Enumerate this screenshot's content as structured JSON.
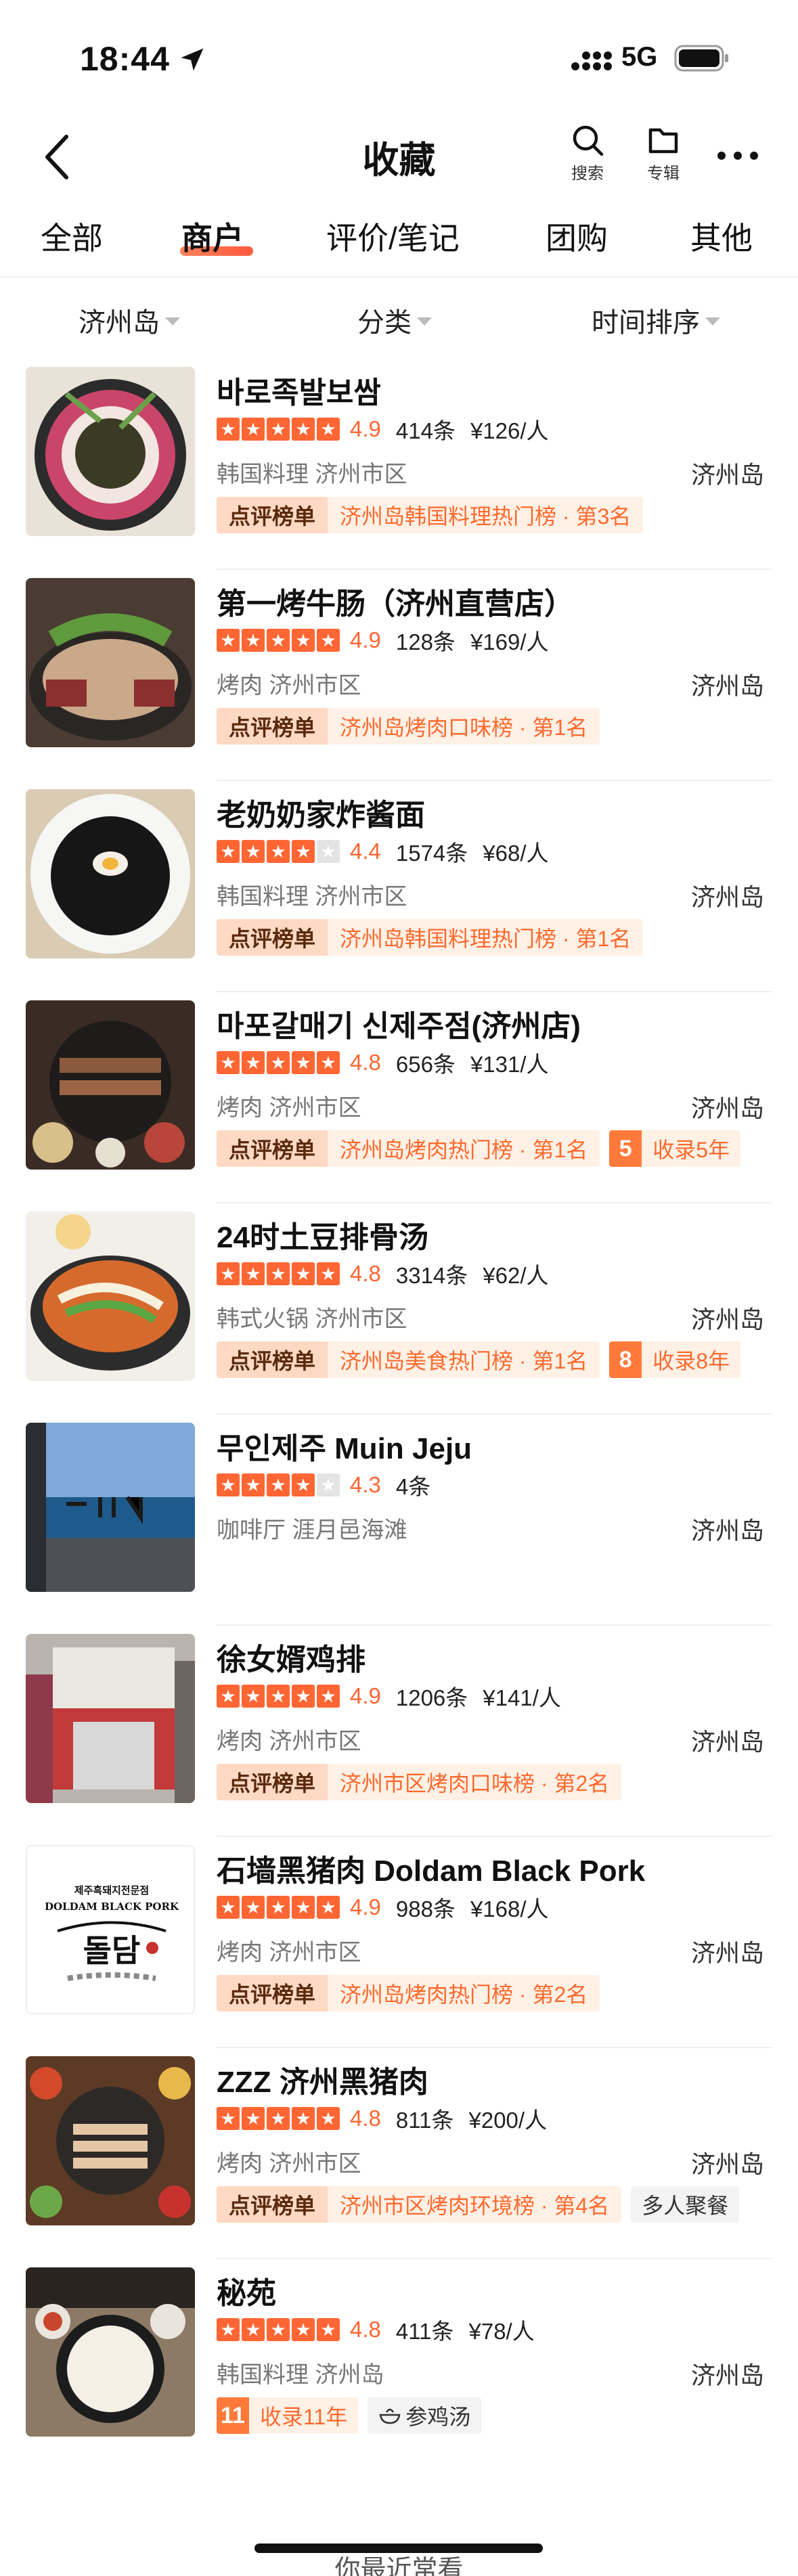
{
  "status": {
    "time": "18:44",
    "network": "5G"
  },
  "nav": {
    "title": "收藏",
    "search_label": "搜索",
    "topic_label": "专辑"
  },
  "tabs": [
    {
      "label": "全部"
    },
    {
      "label": "商户"
    },
    {
      "label": "评价/笔记"
    },
    {
      "label": "团购"
    },
    {
      "label": "其他"
    }
  ],
  "active_tab": "商户",
  "filters": {
    "region": "济州岛",
    "category": "分类",
    "sort": "时间排序"
  },
  "colors": {
    "accent": "#ff6633",
    "rank_head_bg": "#ffd9c4",
    "rank_body_bg": "#fff1e6"
  },
  "items": [
    {
      "name": "바로족발보쌈",
      "stars": 5,
      "score": "4.9",
      "reviews": "414条",
      "price": "¥126/人",
      "category": "韩国料理 济州市区",
      "region": "济州岛",
      "rank_head": "点评榜单",
      "rank_text": "济州岛韩国料理热门榜 · 第3名"
    },
    {
      "name": "第一烤牛肠（济州直营店）",
      "stars": 5,
      "score": "4.9",
      "reviews": "128条",
      "price": "¥169/人",
      "category": "烤肉 济州市区",
      "region": "济州岛",
      "rank_head": "点评榜单",
      "rank_text": "济州岛烤肉口味榜 · 第1名"
    },
    {
      "name": "老奶奶家炸酱面",
      "stars": 4,
      "score": "4.4",
      "reviews": "1574条",
      "price": "¥68/人",
      "category": "韩国料理 济州市区",
      "region": "济州岛",
      "rank_head": "点评榜单",
      "rank_text": "济州岛韩国料理热门榜 · 第1名"
    },
    {
      "name": "마포갈매기 신제주점(济州店)",
      "stars": 5,
      "score": "4.8",
      "reviews": "656条",
      "price": "¥131/人",
      "category": "烤肉 济州市区",
      "region": "济州岛",
      "rank_head": "点评榜单",
      "rank_text": "济州岛烤肉热门榜 · 第1名",
      "years_num": "5",
      "years_text": "收录5年"
    },
    {
      "name": "24时土豆排骨汤",
      "stars": 5,
      "score": "4.8",
      "reviews": "3314条",
      "price": "¥62/人",
      "category": "韩式火锅 济州市区",
      "region": "济州岛",
      "rank_head": "点评榜单",
      "rank_text": "济州岛美食热门榜 · 第1名",
      "years_num": "8",
      "years_text": "收录8年"
    },
    {
      "name": "무인제주 Muin Jeju",
      "stars": 4,
      "score": "4.3",
      "reviews": "4条",
      "price": "",
      "category": "咖啡厅 涯月邑海滩",
      "region": "济州岛"
    },
    {
      "name": "徐女婿鸡排",
      "stars": 5,
      "score": "4.9",
      "reviews": "1206条",
      "price": "¥141/人",
      "category": "烤肉 济州市区",
      "region": "济州岛",
      "rank_head": "点评榜单",
      "rank_text": "济州市区烤肉口味榜 · 第2名"
    },
    {
      "name": "石墙黑猪肉 Doldam Black Pork",
      "stars": 5,
      "score": "4.9",
      "reviews": "988条",
      "price": "¥168/人",
      "category": "烤肉 济州市区",
      "region": "济州岛",
      "rank_head": "点评榜单",
      "rank_text": "济州岛烤肉热门榜 · 第2名",
      "logo_line1": "제주흑돼지전문점",
      "logo_line2": "DOLDAM BLACK PORK",
      "logo_line3": "돌담"
    },
    {
      "name": "ZZZ 济州黑猪肉",
      "stars": 5,
      "score": "4.8",
      "reviews": "811条",
      "price": "¥200/人",
      "category": "烤肉 济州市区",
      "region": "济州岛",
      "rank_head": "点评榜单",
      "rank_text": "济州市区烤肉环境榜 · 第4名",
      "extra_tag": "多人聚餐"
    },
    {
      "name": "秘苑",
      "stars": 5,
      "score": "4.8",
      "reviews": "411条",
      "price": "¥78/人",
      "category": "韩国料理 济州岛",
      "region": "济州岛",
      "years_num": "11",
      "years_text": "收录11年",
      "extra_tag": "参鸡汤"
    }
  ],
  "footer_peek": "你最近常看"
}
